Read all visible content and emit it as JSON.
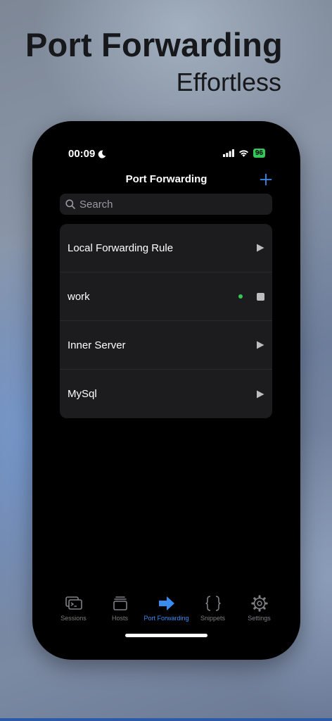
{
  "hero": {
    "title": "Port Forwarding",
    "subtitle": "Effortless"
  },
  "status_bar": {
    "time": "00:09",
    "battery": "96"
  },
  "nav": {
    "title": "Port Forwarding",
    "add_icon": "plus-icon"
  },
  "search": {
    "placeholder": "Search",
    "value": ""
  },
  "rules": [
    {
      "name": "Local Forwarding Rule",
      "state": "stopped",
      "control_icon": "play-icon"
    },
    {
      "name": "work",
      "state": "running",
      "control_icon": "stop-icon"
    },
    {
      "name": "Inner Server",
      "state": "stopped",
      "control_icon": "play-icon"
    },
    {
      "name": "MySql",
      "state": "stopped",
      "control_icon": "play-icon"
    }
  ],
  "tabs": [
    {
      "label": "Sessions",
      "icon": "terminal-windows-icon"
    },
    {
      "label": "Hosts",
      "icon": "server-stack-icon"
    },
    {
      "label": "Port Forwarding",
      "icon": "arrow-right-icon",
      "active": true
    },
    {
      "label": "Snippets",
      "icon": "braces-icon"
    },
    {
      "label": "Settings",
      "icon": "gear-icon"
    }
  ],
  "colors": {
    "accent": "#3b8cf0",
    "running": "#34c759",
    "row_bg": "#1c1c1e"
  }
}
